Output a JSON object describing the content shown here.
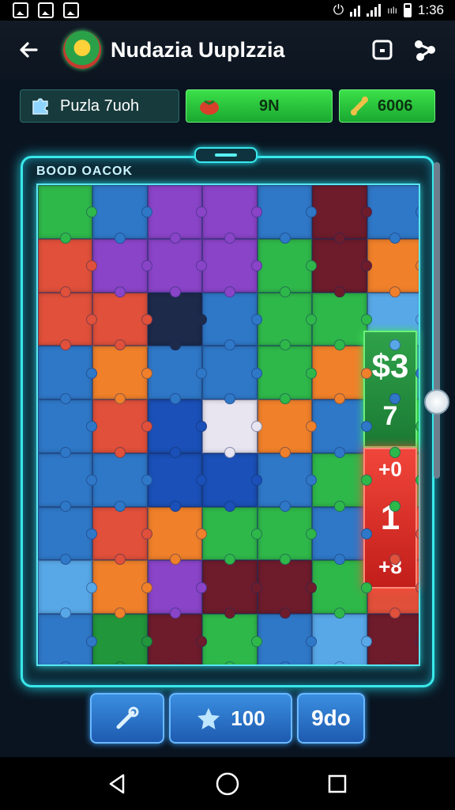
{
  "status_bar": {
    "time": "1:36",
    "signal_text": "ıılı"
  },
  "app_bar": {
    "title": "Nudazia Uuplzzia"
  },
  "stats": {
    "puzzle_label": "Puzla 7uoh",
    "moves_value": "9N",
    "coins_value": "6006"
  },
  "board": {
    "label": "BOOD OACOK"
  },
  "scores": {
    "green_top": "$3",
    "green_bottom": "7",
    "red_top": "+0",
    "red_middle": "1",
    "red_bottom": "+8"
  },
  "actions": {
    "score_value": "100",
    "go_label": "9do"
  },
  "colors": {
    "frame_glow": "#39e8ea",
    "board_blue": "#2f78c8",
    "accent_green": "#2fd14a",
    "accent_red": "#e8322a"
  },
  "icons": [
    "back-arrow-icon",
    "game-logo-icon",
    "save-icon",
    "share-icon",
    "puzzle-icon",
    "tomato-icon",
    "bone-icon",
    "wrench-icon",
    "star-icon",
    "nav-back-icon",
    "nav-home-icon",
    "nav-recents-icon"
  ]
}
